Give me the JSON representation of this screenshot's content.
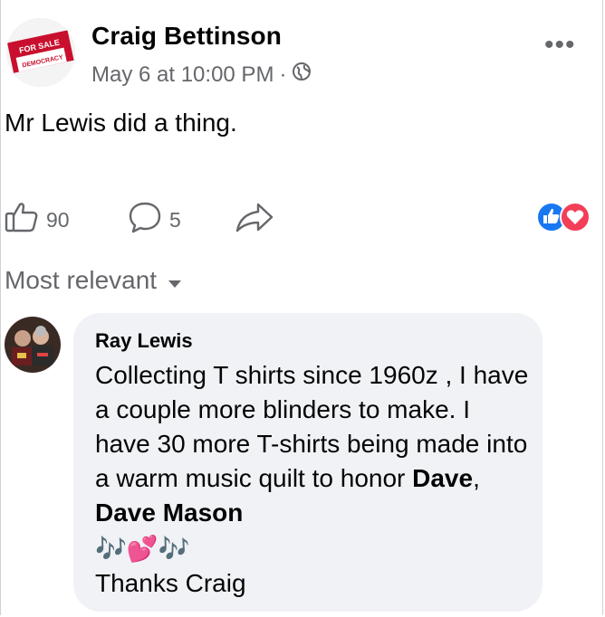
{
  "post": {
    "author": "Craig Bettinson",
    "timestamp": "May 6 at 10:00 PM",
    "separator": "·",
    "audience_icon": "globe-icon",
    "text": "Mr Lewis did a thing.",
    "avatar_texts": [
      "FOR SALE",
      "DEMOCRACY"
    ],
    "more_label": "•••"
  },
  "actions": {
    "likes_count": "90",
    "comments_count": "5"
  },
  "reactions": [
    "like",
    "love"
  ],
  "sort": {
    "label": "Most relevant"
  },
  "comment": {
    "author": "Ray Lewis",
    "line1": "Collecting T shirts since 1960z , I have a couple more blinders to make. I have 30 more T-shirts being made into a warm music quilt to honor ",
    "bold1": "Dave",
    "sep": ", ",
    "bold2": "Dave Mason",
    "emoji_line": "🎶💕🎶",
    "closing": "Thanks Craig"
  },
  "colors": {
    "meta_gray": "#65676b",
    "bubble_bg": "#f0f2f5",
    "like_blue": "#1877f2",
    "love_red": "#f33e58"
  }
}
